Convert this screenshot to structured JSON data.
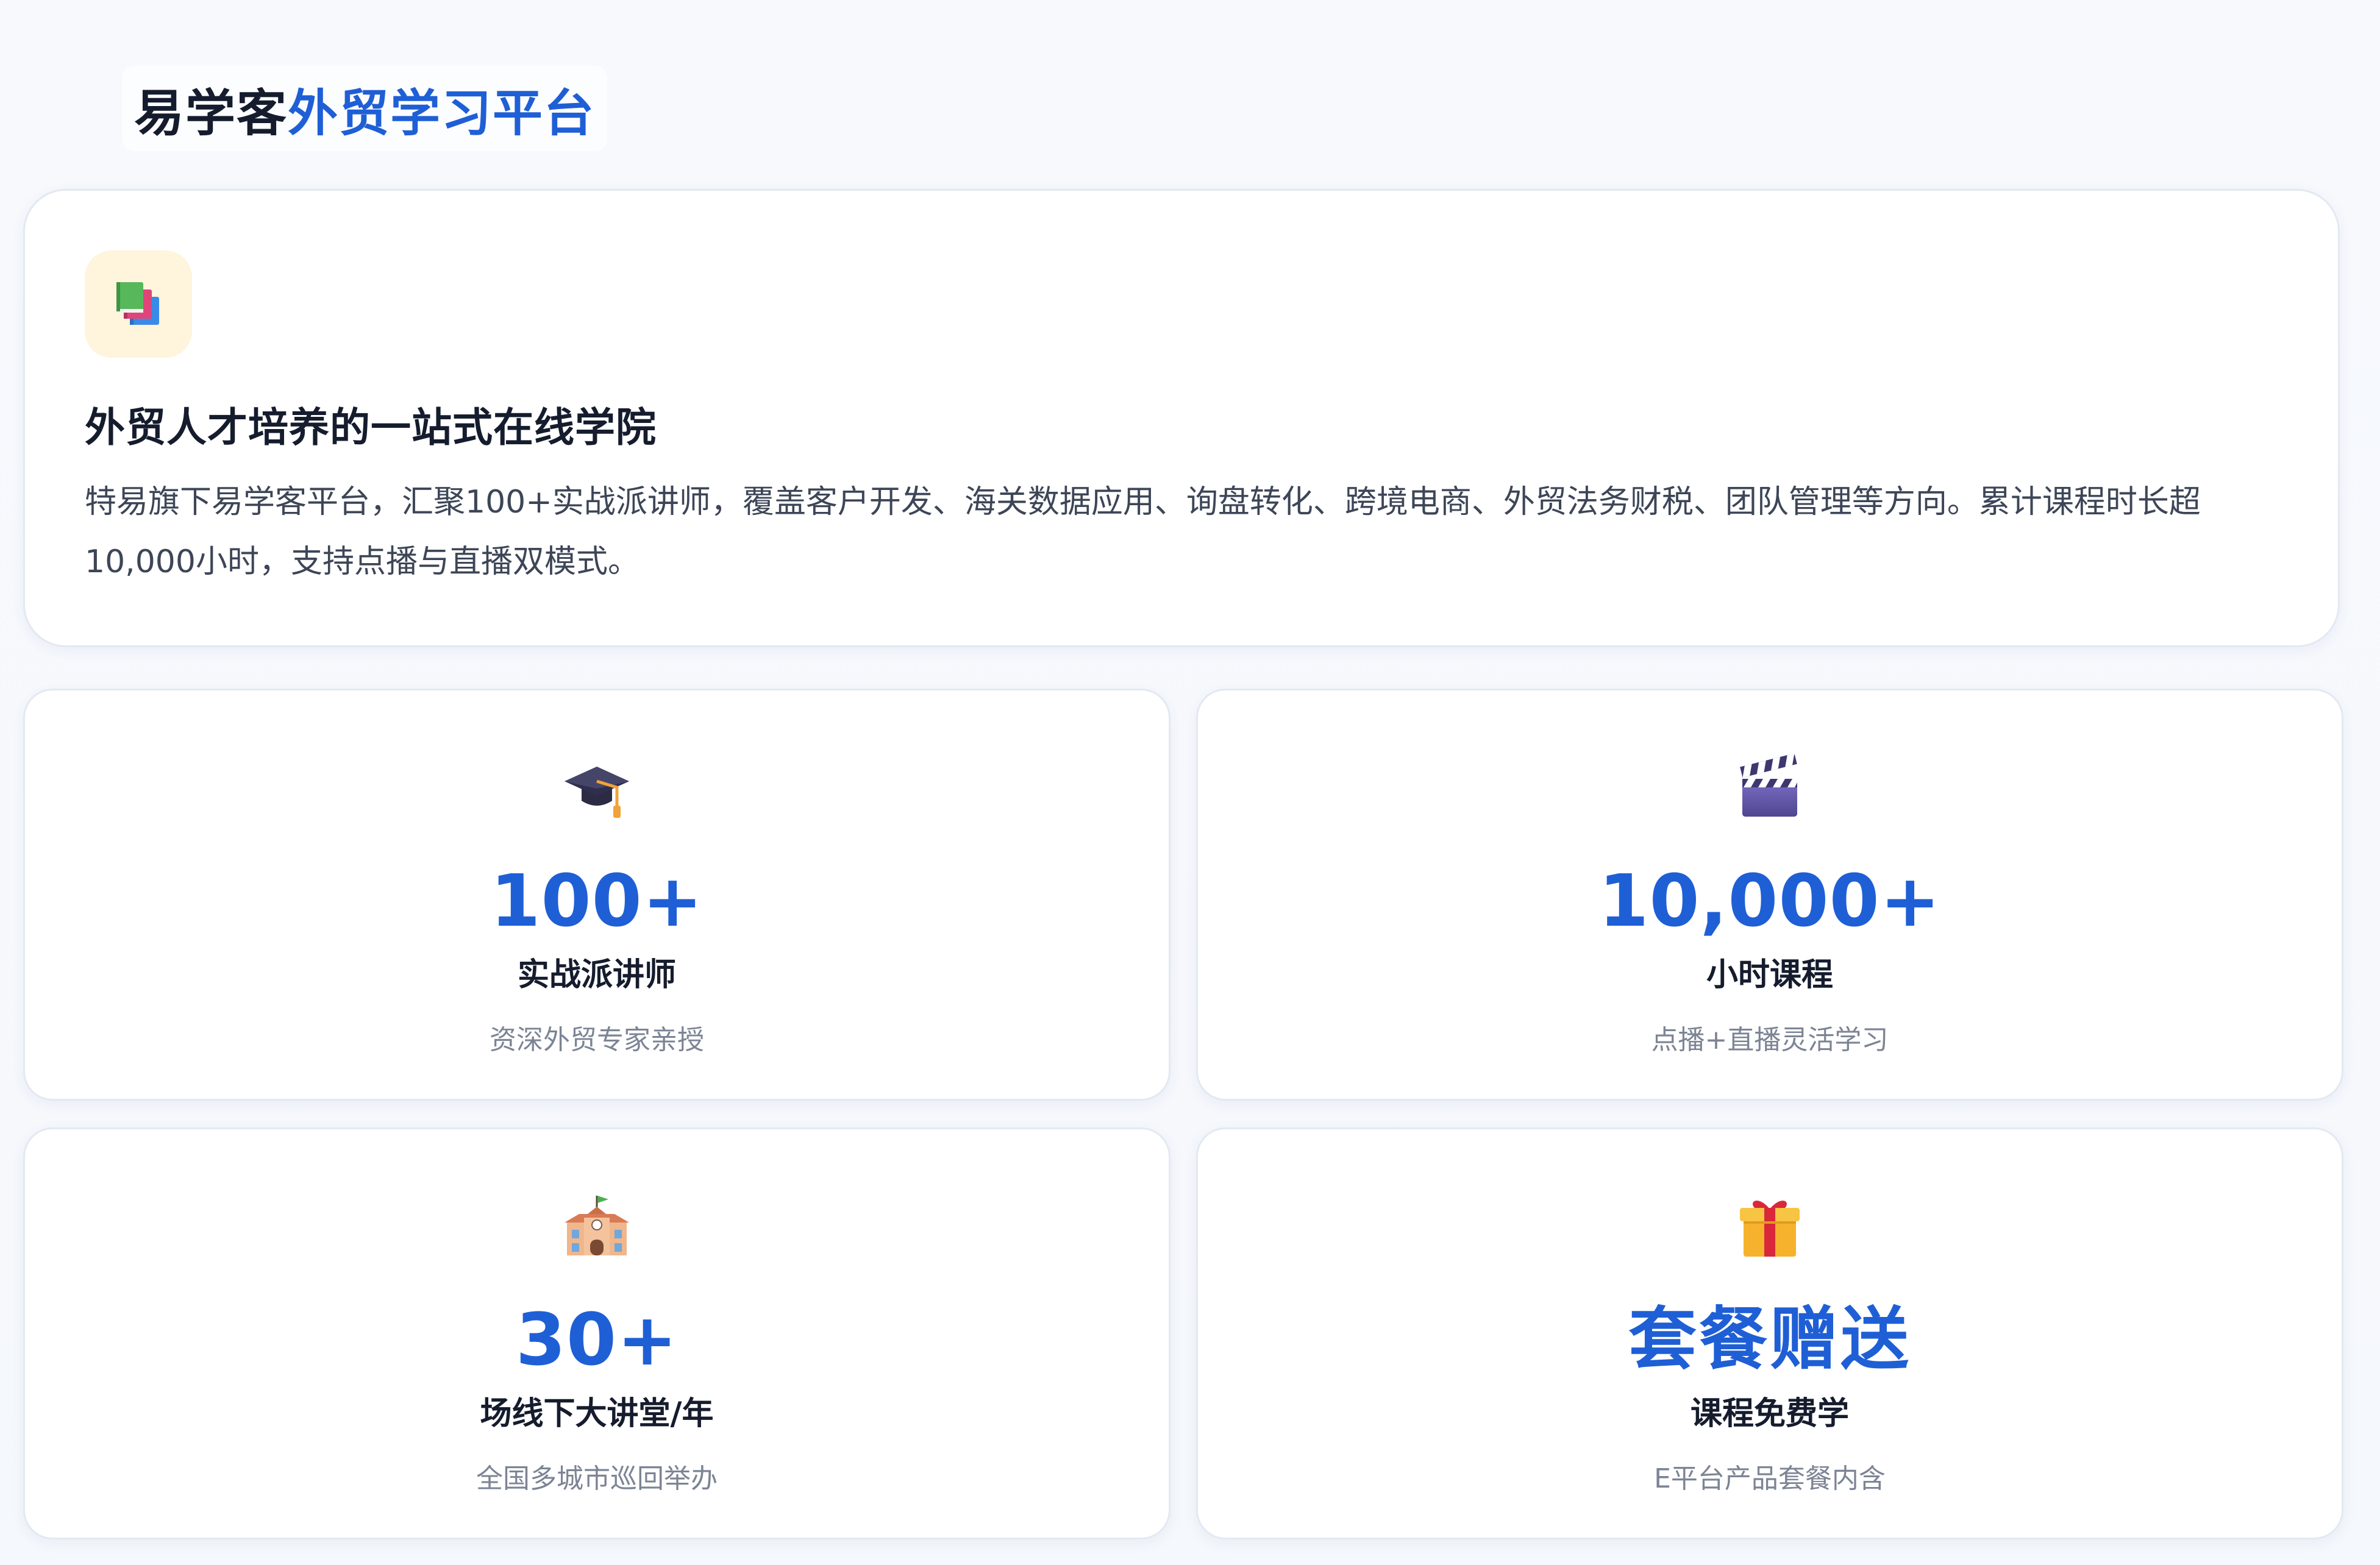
{
  "header": {
    "brand": "易学客",
    "accent": "外贸学习平台"
  },
  "colors": {
    "accent": "#1f5fd6",
    "text_dark": "#151c2d",
    "text_body": "#3d4657",
    "text_muted": "#7c8494",
    "icon_bg": "#fff4dc"
  },
  "intro": {
    "icon": "books-icon",
    "title": "外贸人才培养的一站式在线学院",
    "description": "特易旗下易学客平台，汇聚100+实战派讲师，覆盖客户开发、海关数据应用、询盘转化、跨境电商、外贸法务财税、团队管理等方向。累计课程时长超10,000小时，支持点播与直播双模式。"
  },
  "stats": [
    {
      "icon": "graduation-cap-icon",
      "value": "100+",
      "label": "实战派讲师",
      "sub": "资深外贸专家亲授"
    },
    {
      "icon": "clapperboard-icon",
      "value": "10,000+",
      "label": "小时课程",
      "sub": "点播+直播灵活学习"
    },
    {
      "icon": "school-icon",
      "value": "30+",
      "label": "场线下大讲堂/年",
      "sub": "全国多城市巡回举办"
    },
    {
      "icon": "gift-icon",
      "value": "套餐赠送",
      "label": "课程免费学",
      "sub": "E平台产品套餐内含"
    }
  ]
}
